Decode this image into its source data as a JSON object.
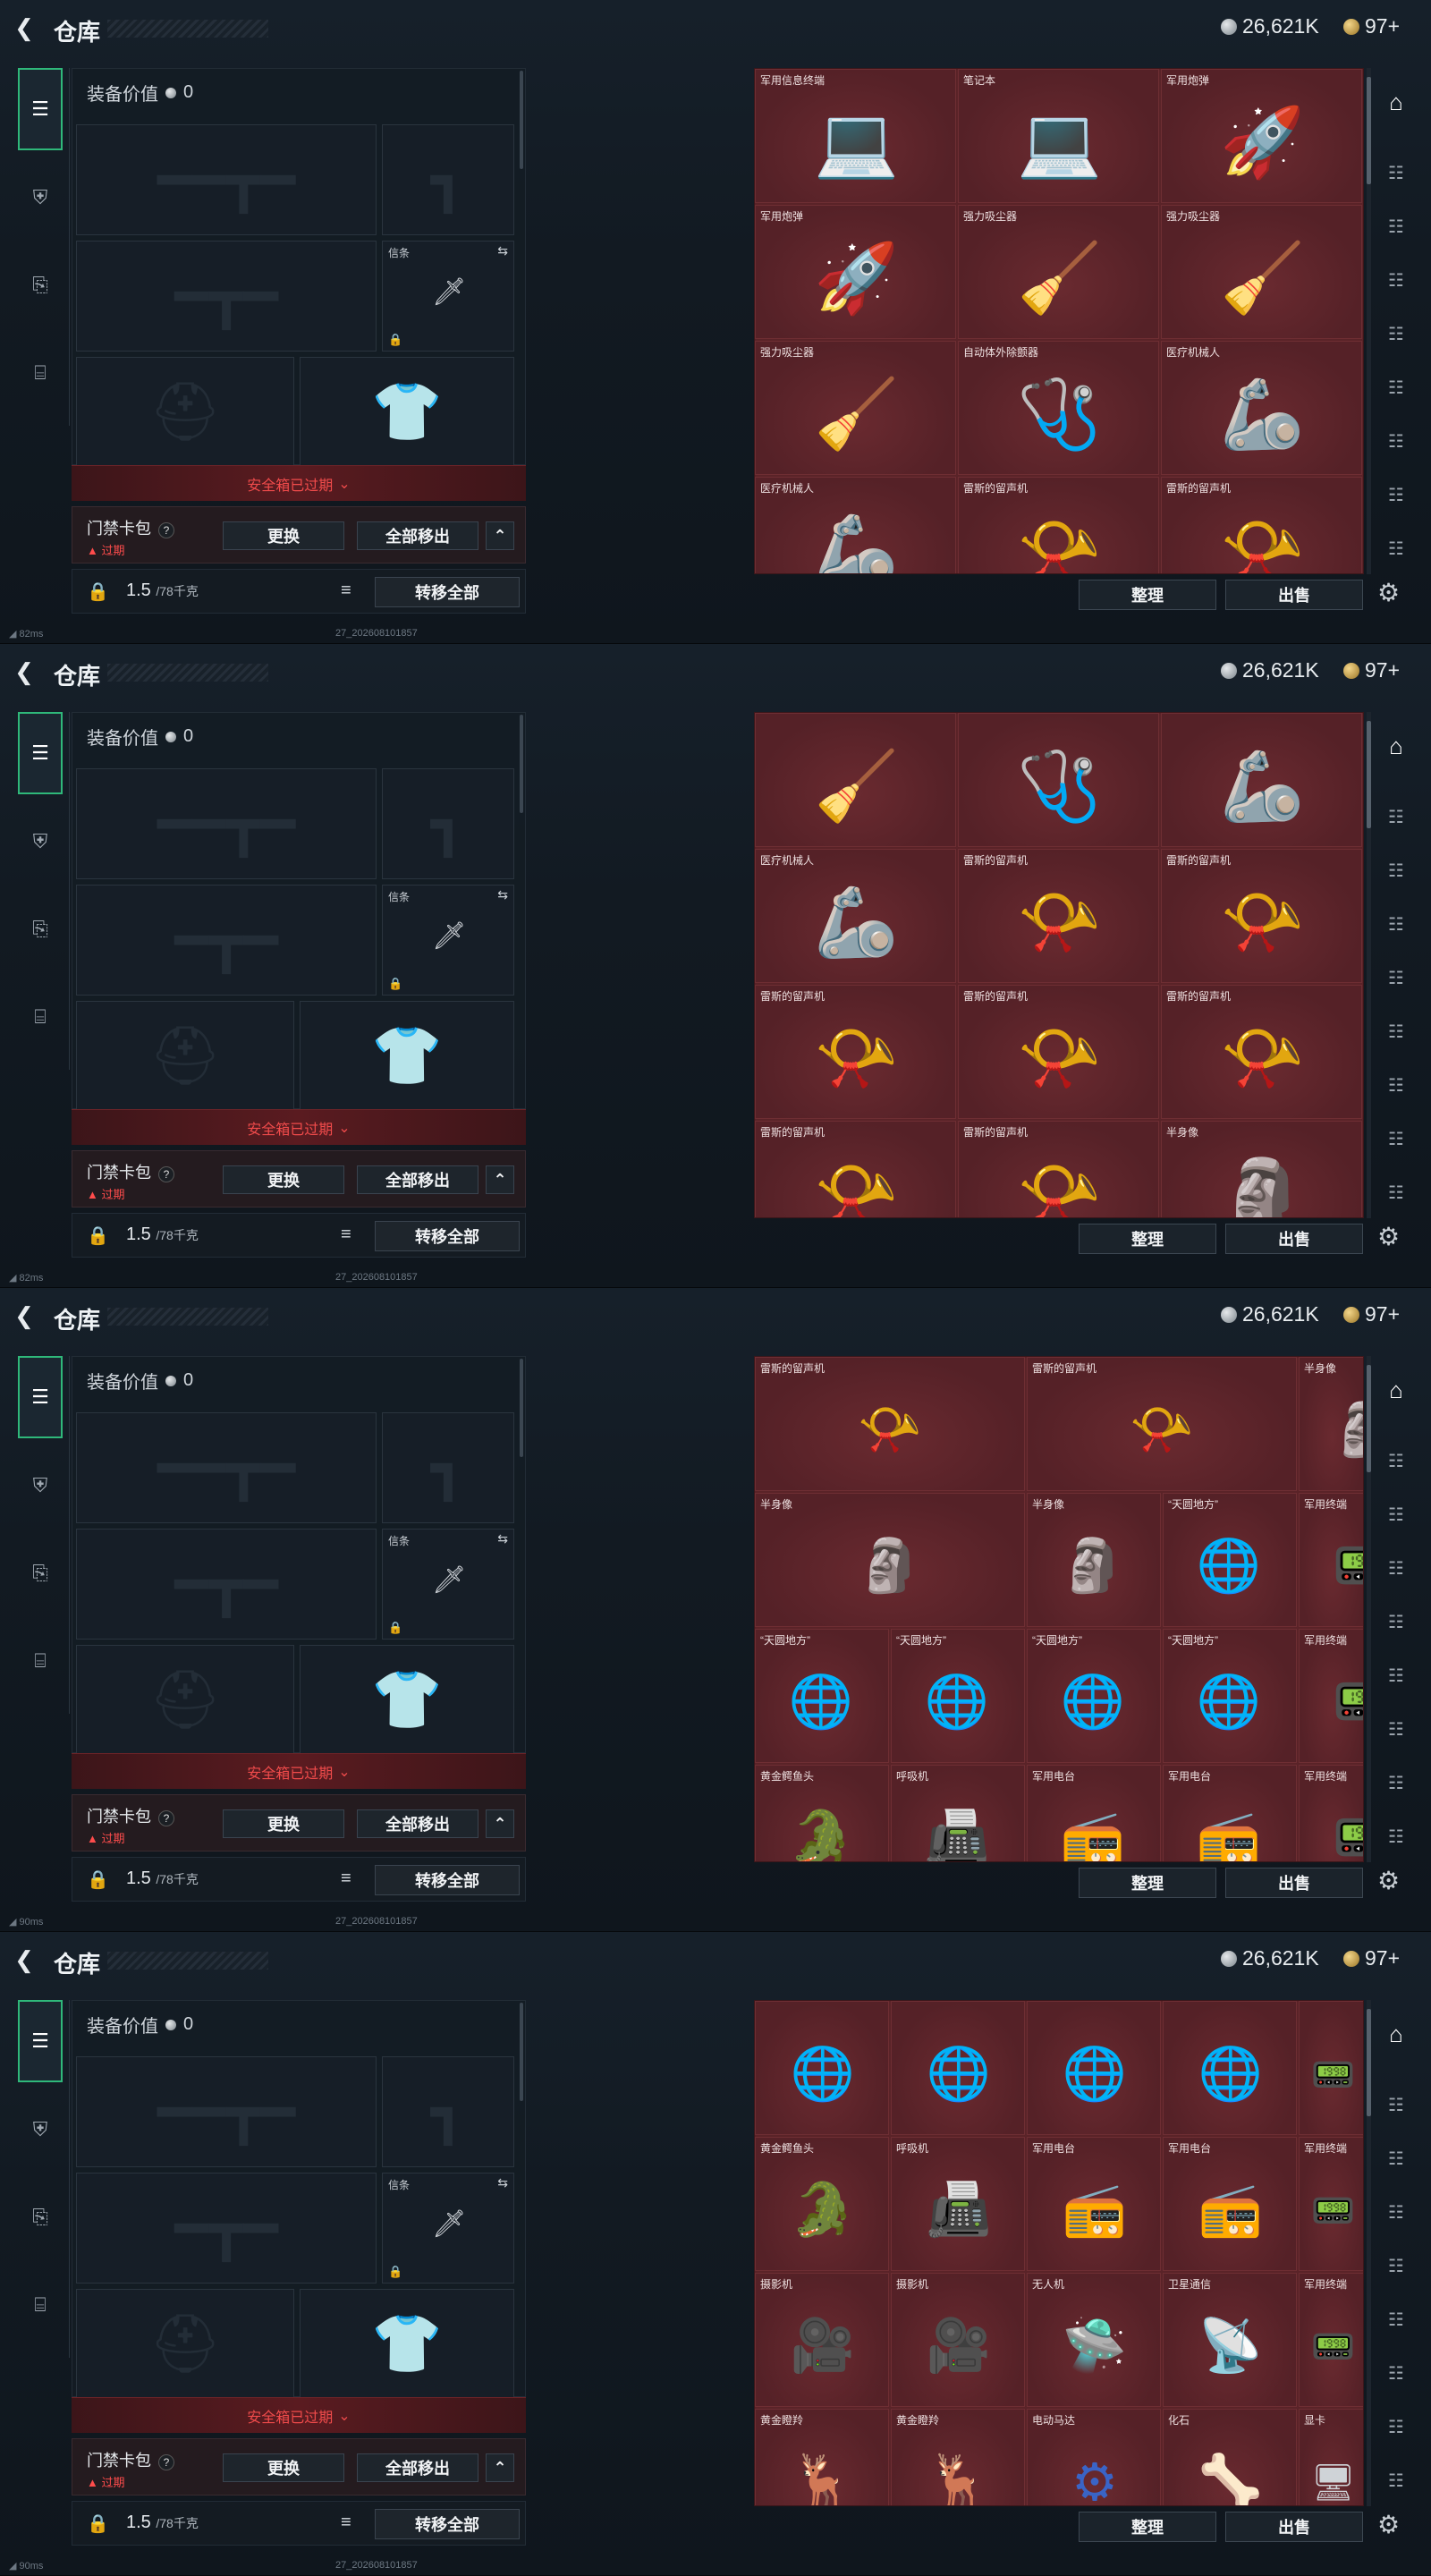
{
  "header": {
    "back_icon": "chevron-left-icon",
    "title": "仓库",
    "silver_amount": "26,621K",
    "gold_amount": "97+"
  },
  "footer": {
    "pings": [
      "82ms",
      "82ms",
      "90ms",
      "90ms"
    ],
    "build": "27_202608101857"
  },
  "loadout": {
    "value_label": "装备价值",
    "value": "0",
    "knife_label": "信条",
    "expired_banner": "安全箱已过期",
    "card_title": "门禁卡包",
    "card_expired": "过期",
    "replace_button": "更换",
    "remove_all_button": "全部移出",
    "weight_value": "1.5",
    "weight_max": "/78千克",
    "transfer_all_button": "转移全部"
  },
  "stash": {
    "sort_button": "整理",
    "sell_button": "出售"
  },
  "panels": [
    {
      "layout": "3col",
      "items": [
        {
          "name": "军用信息终端",
          "icon": "laptop-rugged-icon",
          "glyph": "💻"
        },
        {
          "name": "笔记本",
          "icon": "laptop-icon",
          "glyph": "💻"
        },
        {
          "name": "军用炮弹",
          "icon": "shell-icon",
          "glyph": "🚀"
        },
        {
          "name": "军用炮弹",
          "icon": "shell-icon",
          "glyph": "🚀"
        },
        {
          "name": "强力吸尘器",
          "icon": "vacuum-icon",
          "glyph": "🧹"
        },
        {
          "name": "强力吸尘器",
          "icon": "vacuum-icon",
          "glyph": "🧹"
        },
        {
          "name": "强力吸尘器",
          "icon": "vacuum-icon",
          "glyph": "🧹"
        },
        {
          "name": "自动体外除颤器",
          "icon": "defibrillator-icon",
          "glyph": "🩺"
        },
        {
          "name": "医疗机械人",
          "icon": "robot-arm-icon",
          "glyph": "🦾"
        },
        {
          "name": "医疗机械人",
          "icon": "robot-arm-icon",
          "glyph": "🦾"
        },
        {
          "name": "雷斯的留声机",
          "icon": "gramophone-icon",
          "glyph": "📯"
        },
        {
          "name": "雷斯的留声机",
          "icon": "gramophone-icon",
          "glyph": "📯"
        }
      ]
    },
    {
      "layout": "3col",
      "items": [
        {
          "name": "",
          "icon": "vacuum-icon",
          "glyph": "🧹"
        },
        {
          "name": "",
          "icon": "defibrillator-icon",
          "glyph": "🩺"
        },
        {
          "name": "",
          "icon": "robot-arm-icon",
          "glyph": "🦾"
        },
        {
          "name": "医疗机械人",
          "icon": "robot-arm-icon",
          "glyph": "🦾"
        },
        {
          "name": "雷斯的留声机",
          "icon": "gramophone-icon",
          "glyph": "📯"
        },
        {
          "name": "雷斯的留声机",
          "icon": "gramophone-icon",
          "glyph": "📯"
        },
        {
          "name": "雷斯的留声机",
          "icon": "gramophone-icon",
          "glyph": "📯"
        },
        {
          "name": "雷斯的留声机",
          "icon": "gramophone-icon",
          "glyph": "📯"
        },
        {
          "name": "雷斯的留声机",
          "icon": "gramophone-icon",
          "glyph": "📯"
        },
        {
          "name": "雷斯的留声机",
          "icon": "gramophone-icon",
          "glyph": "📯"
        },
        {
          "name": "雷斯的留声机",
          "icon": "gramophone-icon",
          "glyph": "📯"
        },
        {
          "name": "半身像",
          "icon": "bust-icon",
          "glyph": "🗿"
        }
      ]
    },
    {
      "layout": "mixed",
      "items": [
        {
          "name": "雷斯的留声机",
          "icon": "gramophone-icon",
          "glyph": "📯",
          "span": 2
        },
        {
          "name": "雷斯的留声机",
          "icon": "gramophone-icon",
          "glyph": "📯",
          "span": 2
        },
        {
          "name": "半身像",
          "icon": "bust-icon",
          "glyph": "🗿",
          "span": 1
        },
        {
          "name": "半身像",
          "icon": "bust-icon",
          "glyph": "🗿",
          "span": 2
        },
        {
          "name": "半身像",
          "icon": "bust-icon",
          "glyph": "🗿",
          "span": 1
        },
        {
          "name": "“天圆地方”",
          "icon": "armillary-icon",
          "glyph": "🌐",
          "span": 1
        },
        {
          "name": "军用终端",
          "icon": "terminal-icon",
          "glyph": "📟",
          "span": 1
        },
        {
          "name": "“天圆地方”",
          "icon": "armillary-icon",
          "glyph": "🌐",
          "span": 1
        },
        {
          "name": "“天圆地方”",
          "icon": "armillary-icon",
          "glyph": "🌐",
          "span": 1
        },
        {
          "name": "“天圆地方”",
          "icon": "armillary-icon",
          "glyph": "🌐",
          "span": 1
        },
        {
          "name": "“天圆地方”",
          "icon": "armillary-icon",
          "glyph": "🌐",
          "span": 1
        },
        {
          "name": "军用终端",
          "icon": "terminal-icon",
          "glyph": "📟",
          "span": 1
        },
        {
          "name": "黄金鳄鱼头",
          "icon": "croc-head-icon",
          "glyph": "🐊",
          "span": 1
        },
        {
          "name": "呼吸机",
          "icon": "ventilator-icon",
          "glyph": "📠",
          "span": 1
        },
        {
          "name": "军用电台",
          "icon": "radio-icon",
          "glyph": "📻",
          "span": 1
        },
        {
          "name": "军用电台",
          "icon": "radio-icon",
          "glyph": "📻",
          "span": 1
        },
        {
          "name": "军用终端",
          "icon": "terminal-icon",
          "glyph": "📟",
          "span": 1
        }
      ]
    },
    {
      "layout": "4col",
      "items": [
        {
          "name": "",
          "icon": "armillary-icon",
          "glyph": "🌐"
        },
        {
          "name": "",
          "icon": "armillary-icon",
          "glyph": "🌐"
        },
        {
          "name": "",
          "icon": "armillary-icon",
          "glyph": "🌐"
        },
        {
          "name": "",
          "icon": "armillary-icon",
          "glyph": "🌐"
        },
        {
          "name": "",
          "icon": "terminal-icon",
          "glyph": "📟",
          "narrow": true
        },
        {
          "name": "黄金鳄鱼头",
          "icon": "croc-head-icon",
          "glyph": "🐊"
        },
        {
          "name": "呼吸机",
          "icon": "ventilator-icon",
          "glyph": "📠"
        },
        {
          "name": "军用电台",
          "icon": "radio-icon",
          "glyph": "📻"
        },
        {
          "name": "军用电台",
          "icon": "radio-icon",
          "glyph": "📻"
        },
        {
          "name": "军用终端",
          "icon": "terminal-icon",
          "glyph": "📟",
          "narrow": true
        },
        {
          "name": "摄影机",
          "icon": "camera-icon",
          "glyph": "🎥"
        },
        {
          "name": "摄影机",
          "icon": "camera-icon",
          "glyph": "🎥"
        },
        {
          "name": "无人机",
          "icon": "drone-icon",
          "glyph": "🛸"
        },
        {
          "name": "卫星通信",
          "icon": "satellite-dish-icon",
          "glyph": "📡"
        },
        {
          "name": "军用终端",
          "icon": "terminal-icon",
          "glyph": "📟",
          "narrow": true
        },
        {
          "name": "黄金瞪羚",
          "icon": "gazelle-icon",
          "glyph": "🦌"
        },
        {
          "name": "黄金瞪羚",
          "icon": "gazelle-icon",
          "glyph": "🦌"
        },
        {
          "name": "电动马达",
          "icon": "motor-icon",
          "glyph": "⚙"
        },
        {
          "name": "化石",
          "icon": "fossil-icon",
          "glyph": "🦴"
        },
        {
          "name": "显卡",
          "icon": "gpu-icon",
          "glyph": "🖥",
          "narrow": true
        }
      ]
    }
  ],
  "colors": {
    "accent": "#2fb87a",
    "stash_bg": "#5a2328",
    "warning": "#f04b4b"
  }
}
